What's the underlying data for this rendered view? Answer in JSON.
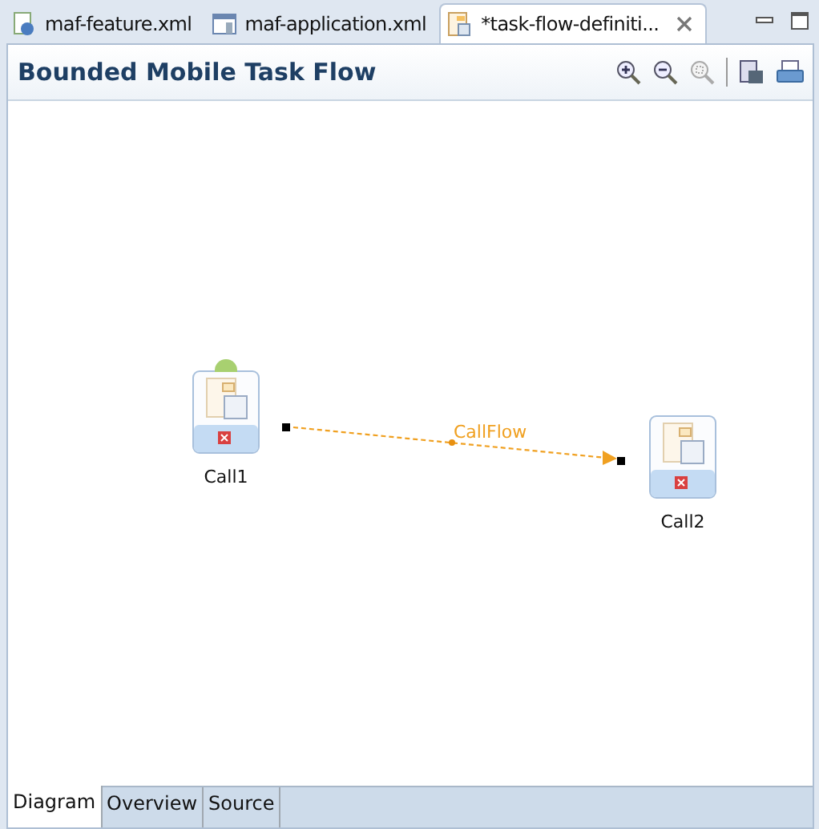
{
  "editor_tabs": [
    {
      "label": "maf-feature.xml",
      "kind": "feature",
      "selected": false
    },
    {
      "label": "maf-application.xml",
      "kind": "application",
      "selected": false
    },
    {
      "label": "*task-flow-definiti...",
      "kind": "taskflow",
      "selected": true
    }
  ],
  "header": {
    "title": "Bounded Mobile Task Flow"
  },
  "nodes": [
    {
      "label": "Call1",
      "default_activity": true
    },
    {
      "label": "Call2",
      "default_activity": false
    }
  ],
  "edge": {
    "label": "CallFlow"
  },
  "bottom_tabs": [
    {
      "label": "Diagram",
      "selected": true
    },
    {
      "label": "Overview",
      "selected": false
    },
    {
      "label": "Source",
      "selected": false
    }
  ]
}
